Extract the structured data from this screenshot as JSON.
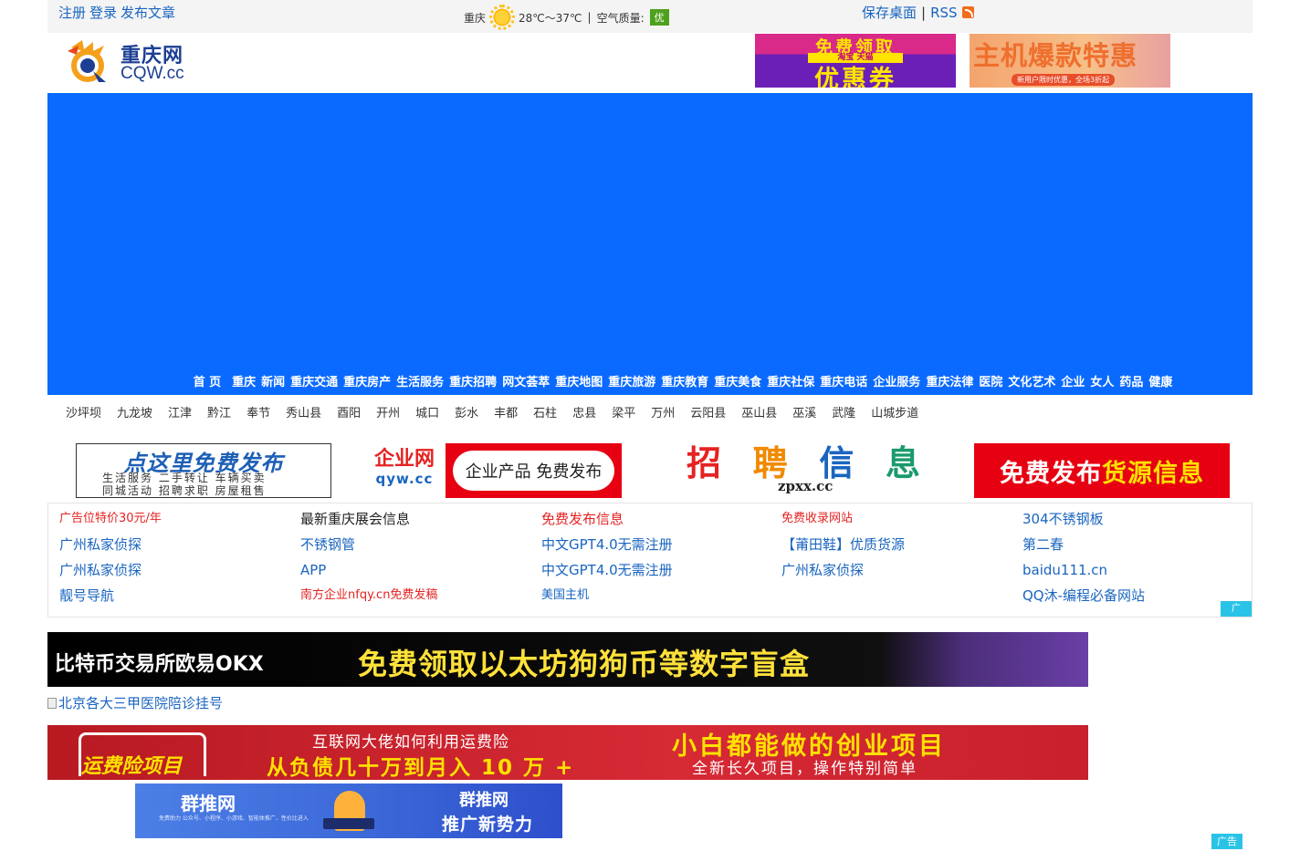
{
  "header": {
    "links": [
      "注册",
      "登录",
      "发布文章"
    ],
    "weather": {
      "city": "重庆",
      "temp": "28℃～37℃",
      "sep": "|",
      "aq_label": "空气质量:",
      "aq_value": "优",
      "icon": "sun-icon"
    },
    "save_desktop": "保存桌面",
    "save_sep": "|",
    "rss": "RSS",
    "logo": {
      "cn": "重庆网",
      "en": "CQW.cc"
    }
  },
  "top_ads": {
    "ad1": {
      "line1": "免费领取",
      "line2": "淘宝 天猫",
      "line3": "优惠券"
    },
    "ad2": {
      "line1": "主机爆款特惠",
      "line2": "新用户限时优惠，全场3折起"
    }
  },
  "nav": [
    "首 页",
    "重庆",
    "新闻",
    "重庆交通",
    "重庆房产",
    "生活服务",
    "重庆招聘",
    "网文荟萃",
    "重庆地图",
    "重庆旅游",
    "重庆教育",
    "重庆美食",
    "重庆社保",
    "重庆电话",
    "企业服务",
    "重庆法律",
    "医院",
    "文化艺术",
    "企业",
    "女人",
    "药品",
    "健康"
  ],
  "subnav": [
    "沙坪坝",
    "九龙坡",
    "江津",
    "黔江",
    "奉节",
    "秀山县",
    "酉阳",
    "开州",
    "城口",
    "彭水",
    "丰都",
    "石柱",
    "忠县",
    "梁平",
    "万州",
    "云阳县",
    "巫山县",
    "巫溪",
    "武隆",
    "山城步道"
  ],
  "promo": {
    "free_post": {
      "title": "点这里免费发布",
      "row1": "生活服务  二手转让  车辆买卖",
      "row2": "同城活动  招聘求职  房屋租售"
    },
    "qyw": {
      "name": "企业网",
      "domain": "qyw.cc",
      "button": "企业产品 免费发布"
    },
    "zpxx": {
      "chars": [
        "招",
        "聘",
        "信",
        "息"
      ],
      "domain": "zpxx.cc"
    },
    "huoyuan": {
      "part1": "免费发布",
      "part2": "货源信息"
    }
  },
  "link_grid": [
    [
      {
        "t": "广告位特价30元/年",
        "c": "red",
        "s": true
      },
      {
        "t": "最新重庆展会信息",
        "c": "dark"
      },
      {
        "t": "免费发布信息",
        "c": "red"
      },
      {
        "t": "免费收录网站",
        "c": "red",
        "s": true
      },
      {
        "t": "304不锈钢板",
        "c": "blue"
      }
    ],
    [
      {
        "t": "广州私家侦探",
        "c": "blue"
      },
      {
        "t": "不锈钢管",
        "c": "blue"
      },
      {
        "t": "中文GPT4.0无需注册",
        "c": "blue"
      },
      {
        "t": "【莆田鞋】优质货源",
        "c": "blue"
      },
      {
        "t": "第二春",
        "c": "blue"
      }
    ],
    [
      {
        "t": "广州私家侦探",
        "c": "blue"
      },
      {
        "t": "APP",
        "c": "blue"
      },
      {
        "t": "中文GPT4.0无需注册",
        "c": "blue"
      },
      {
        "t": "广州私家侦探",
        "c": "blue"
      },
      {
        "t": "baidu111.cn",
        "c": "blue"
      }
    ],
    [
      {
        "t": "靓号导航",
        "c": "blue"
      },
      {
        "t": "南方企业nfqy.cn免费发稿",
        "c": "red",
        "s": true
      },
      {
        "t": "美国主机",
        "c": "blue",
        "s": true
      },
      {
        "t": "",
        "c": "blue"
      },
      {
        "t": "QQ沐-编程必备网站",
        "c": "blue"
      }
    ]
  ],
  "grid_tag": "广",
  "banners": {
    "okx": {
      "left": "比特币交易所欧易OKX",
      "right": "免费领取以太坊狗狗币等数字盲盒"
    },
    "broken_img": "北京各大三甲医院陪诊挂号",
    "yfx": {
      "tag": "运费险项目",
      "l1": "互联网大佬如何利用运费险",
      "l2": "从负债几十万到月入 10 万 +",
      "r1": "小白都能做的创业项目",
      "r2": "全新长久项目，操作特别简单"
    },
    "qtw": {
      "name": "群推网",
      "small": "免费助力 公众号、小程序、小游戏、智能体推广、性价比进入",
      "title": "群推网",
      "slogan": "推广新势力"
    }
  },
  "ad_tag": "广告",
  "colors": {
    "nav_blue": "#0a6aff",
    "link_blue": "#1a65c0",
    "red": "#e52222",
    "ad_tag": "#2ac3e8"
  }
}
